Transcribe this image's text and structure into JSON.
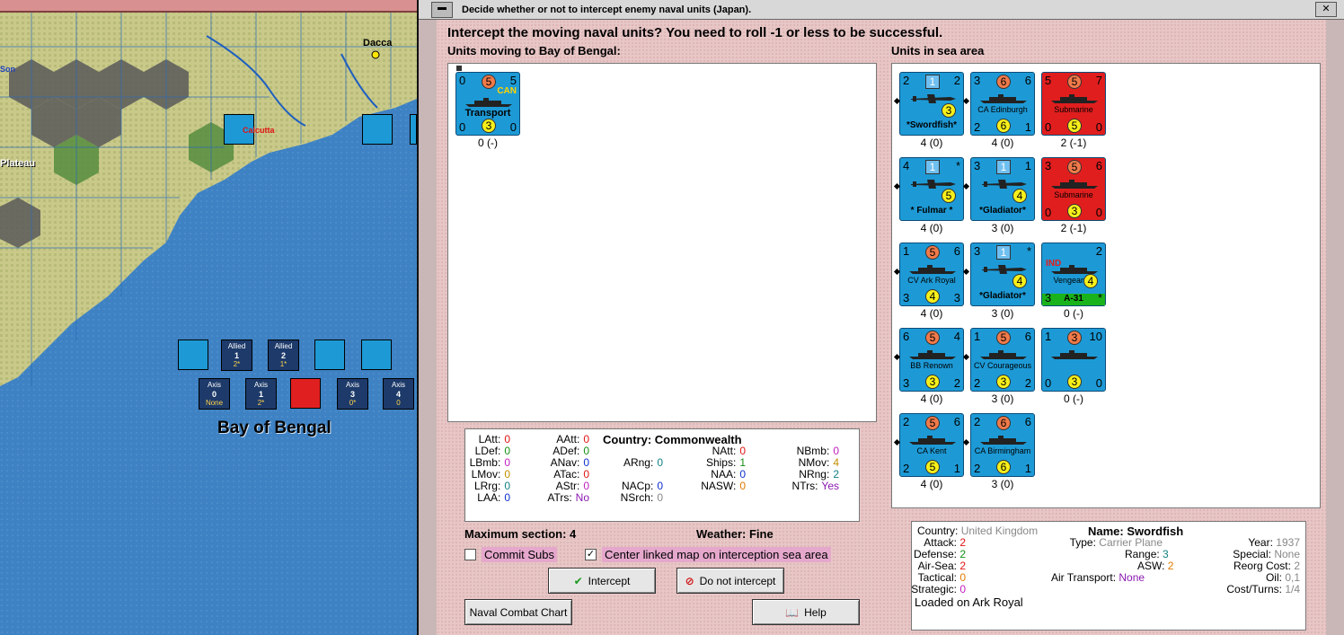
{
  "window": {
    "title": "Decide whether or not to intercept enemy naval units (Japan).",
    "heading": "Intercept the moving naval units?  You need to roll -1 or less to be successful."
  },
  "map": {
    "labels": {
      "dacca": "Dacca",
      "calcutta": "Calcutta",
      "plateau": "Plateau",
      "son": "Son",
      "sea_area": "Bay of Bengal"
    },
    "allied_boxes": [
      {
        "title": "Allied",
        "number": "1",
        "sub": "2*"
      },
      {
        "title": "Allied",
        "number": "2",
        "sub": "1*"
      }
    ],
    "axis_boxes": [
      {
        "title": "Axis",
        "number": "0",
        "sub": "None"
      },
      {
        "title": "Axis",
        "number": "1",
        "sub": "2*"
      },
      {
        "title": "Axis",
        "number": "3",
        "sub": "0*"
      },
      {
        "title": "Axis",
        "number": "4",
        "sub": "0"
      }
    ]
  },
  "moving": {
    "label": "Units moving to Bay of Bengal:",
    "units": [
      {
        "tl": "0",
        "tr": "5",
        "top": "5",
        "tag": "CAN",
        "name": "Transport",
        "bl": "0",
        "bot": "3",
        "br": "0",
        "caption": "0 (-)"
      }
    ]
  },
  "sea": {
    "label": "Units in sea area",
    "units": [
      {
        "tl": "2",
        "tr": "2",
        "top": "1",
        "mid": "3",
        "name": "*Swordfish*",
        "bl": "",
        "bot": "",
        "br": "",
        "caption": "4 (0)",
        "red": false
      },
      {
        "tl": "3",
        "tr": "6",
        "top": "6",
        "name": "CA Edinburgh",
        "bl": "2",
        "bot": "6",
        "br": "1",
        "caption": "4 (0)",
        "red": false
      },
      {
        "tl": "5",
        "tr": "7",
        "top": "5",
        "name": "Submarine",
        "bl": "0",
        "bot": "5",
        "br": "0",
        "caption": "2 (-1)",
        "red": true
      },
      {
        "tl": "4",
        "tr": "*",
        "top": "1",
        "mid": "5",
        "name": "* Fulmar *",
        "bl": "",
        "bot": "",
        "br": "",
        "caption": "4 (0)",
        "red": false
      },
      {
        "tl": "3",
        "tr": "1",
        "top": "1",
        "mid": "4",
        "name": "*Gladiator*",
        "bl": "",
        "bot": "",
        "br": "",
        "caption": "3 (0)",
        "red": false
      },
      {
        "tl": "3",
        "tr": "6",
        "top": "5",
        "name": "Submarine",
        "bl": "0",
        "bot": "3",
        "br": "0",
        "caption": "2 (-1)",
        "red": true
      },
      {
        "tl": "1",
        "tr": "6",
        "top": "5",
        "name": "CV Ark Royal",
        "bl": "3",
        "bot": "4",
        "br": "3",
        "caption": "4 (0)",
        "red": false
      },
      {
        "tl": "3",
        "tr": "*",
        "top": "1",
        "mid": "4",
        "name": "*Gladiator*",
        "bl": "",
        "bot": "",
        "br": "",
        "caption": "3 (0)",
        "red": false
      },
      {
        "tl": "",
        "tr": "2",
        "top": "",
        "tag": "IND",
        "name": "Vengeance",
        "mid": "4",
        "bl": "3",
        "bot": "A-31",
        "br": "*",
        "caption": "0 (-)",
        "red": false
      },
      {
        "tl": "6",
        "tr": "4",
        "top": "5",
        "name": "BB Renown",
        "bl": "3",
        "bot": "3",
        "br": "2",
        "caption": "4 (0)",
        "red": false
      },
      {
        "tl": "1",
        "tr": "6",
        "top": "5",
        "name": "CV Courageous",
        "bl": "2",
        "bot": "3",
        "br": "2",
        "caption": "3 (0)",
        "red": false
      },
      {
        "tl": "1",
        "tr": "10",
        "top": "3",
        "name": "",
        "bl": "0",
        "bot": "3",
        "br": "0",
        "caption": "0 (-)",
        "red": false
      },
      {
        "tl": "2",
        "tr": "6",
        "top": "5",
        "name": "CA Kent",
        "bl": "2",
        "bot": "5",
        "br": "1",
        "caption": "4 (0)",
        "red": false
      },
      {
        "tl": "2",
        "tr": "6",
        "top": "6",
        "name": "CA Birmingham",
        "bl": "2",
        "bot": "6",
        "br": "1",
        "caption": "3 (0)",
        "red": false
      }
    ]
  },
  "stats": {
    "country_label": "Country:",
    "country": "Commonwealth",
    "col1": [
      [
        "LAtt:",
        "0"
      ],
      [
        "LDef:",
        "0"
      ],
      [
        "LBmb:",
        "0"
      ],
      [
        "LMov:",
        "0"
      ],
      [
        "LRrg:",
        "0"
      ],
      [
        "LAA:",
        "0"
      ]
    ],
    "col2": [
      [
        "AAtt:",
        "0"
      ],
      [
        "ADef:",
        "0"
      ],
      [
        "ANav:",
        "0"
      ],
      [
        "ATac:",
        "0"
      ],
      [
        "AStr:",
        "0"
      ],
      [
        "ATrs:",
        "No"
      ]
    ],
    "col3": [
      [
        "ARng:",
        "0"
      ],
      [
        "NACp:",
        "0"
      ],
      [
        "NSrch:",
        "0"
      ]
    ],
    "col4": [
      [
        "NAtt:",
        "0"
      ],
      [
        "Ships:",
        "1"
      ],
      [
        "NAA:",
        "0"
      ],
      [
        "NASW:",
        "0"
      ]
    ],
    "col5": [
      [
        "NBmb:",
        "0"
      ],
      [
        "NMov:",
        "4"
      ],
      [
        "NRng:",
        "2"
      ],
      [
        "NTrs:",
        "Yes"
      ]
    ]
  },
  "status": {
    "max_section": "Maximum section: 4",
    "weather": "Weather:  Fine"
  },
  "options": {
    "commit_subs": "Commit Subs",
    "center_map": "Center linked map on interception sea area",
    "commit_subs_checked": false,
    "center_map_checked": true
  },
  "buttons": {
    "intercept": "Intercept",
    "do_not_intercept": "Do not intercept",
    "naval_chart": "Naval Combat Chart",
    "help": "Help"
  },
  "unit_info": {
    "country_label": "Country:",
    "country": "United Kingdom",
    "name_label": "Name:",
    "name": "Swordfish",
    "attack_label": "Attack:",
    "attack": "2",
    "defense_label": "Defense:",
    "defense": "2",
    "airsea_label": "Air-Sea:",
    "airsea": "2",
    "tactical_label": "Tactical:",
    "tactical": "0",
    "strategic_label": "Strategic:",
    "strategic": "0",
    "type_label": "Type:",
    "type": "Carrier Plane",
    "range_label": "Range:",
    "range": "3",
    "asw_label": "ASW:",
    "asw": "2",
    "airtransport_label": "Air Transport:",
    "airtransport": "None",
    "year_label": "Year:",
    "year": "1937",
    "special_label": "Special:",
    "special": "None",
    "reorg_label": "Reorg Cost:",
    "reorg": "2",
    "oil_label": "Oil:",
    "oil": "0,1",
    "costturns_label": "Cost/Turns:",
    "costturns": "1/4",
    "loaded": "Loaded on Ark Royal"
  },
  "colors": {
    "allied_counter": "#1d9ad6",
    "sub_counter": "#e01e1e",
    "dialog_bg": "#e8c6c6"
  }
}
